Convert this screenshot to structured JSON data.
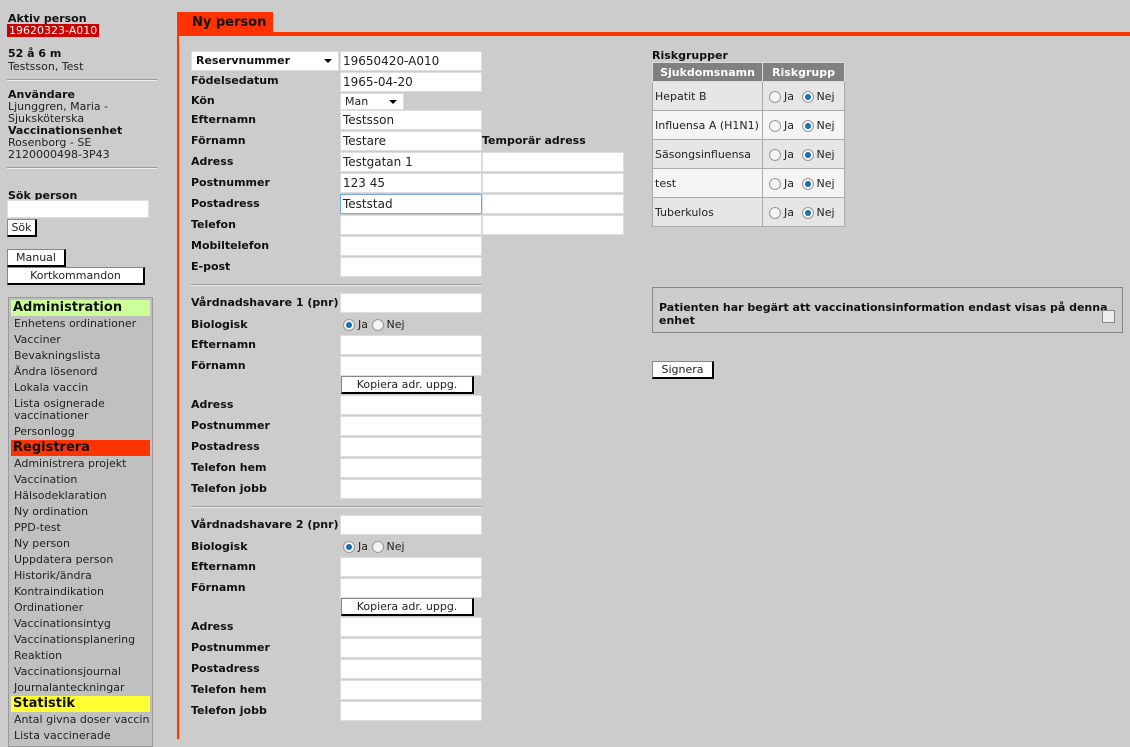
{
  "sidebar": {
    "active_person_label": "Aktiv person",
    "active_person_id": "19620323-A010",
    "age": "52 å 6 m",
    "name": "Testsson, Test",
    "user_label": "Användare",
    "user_name": "Ljunggren, Maria -",
    "user_role": "Sjuksköterska",
    "unit_label": "Vaccinationsenhet",
    "unit_name": "Rosenborg - SE",
    "unit_id": "2120000498-3P43",
    "search_label": "Sök person",
    "search_value": "",
    "search_button": "Sök",
    "manual_button": "Manual",
    "shortcuts_button": "Kortkommandon",
    "menu": {
      "admin_header": "Administration",
      "admin_items": [
        "Enhetens ordinationer",
        "Vacciner",
        "Bevakningslista",
        "Ändra lösenord",
        "Lokala vaccin",
        "Lista osignerade vaccinationer",
        "Personlogg"
      ],
      "register_header": "Registrera",
      "register_items": [
        "Administrera projekt",
        "Vaccination",
        "Hälsodeklaration",
        "Ny ordination",
        "PPD-test",
        "Ny person",
        "Uppdatera person",
        "Historik/ändra",
        "Kontraindikation",
        "Ordinationer",
        "Vaccinationsintyg",
        "Vaccinationsplanering",
        "Reaktion",
        "Vaccinationsjournal",
        "Journalanteckningar"
      ],
      "stats_header": "Statistik",
      "stats_items": [
        "Antal givna doser vaccin",
        "Lista vaccinerade"
      ]
    }
  },
  "colors": {
    "accent": "#ff3300",
    "admin": "#ccff99",
    "stats": "#ffff33",
    "active_id_bg": "#cc0000"
  },
  "tab": {
    "title": "Ny person"
  },
  "form": {
    "id_type": "Reservnummer",
    "id_value": "19650420-A010",
    "birthdate_label": "Födelsedatum",
    "birthdate": "1965-04-20",
    "sex_label": "Kön",
    "sex": "Man",
    "lastname_label": "Efternamn",
    "lastname": "Testsson",
    "firstname_label": "Förnamn",
    "firstname": "Testare",
    "temp_address_label": "Temporär adress",
    "address_label": "Adress",
    "address": "Testgatan 1",
    "zip_label": "Postnummer",
    "zip": "123 45",
    "city_label": "Postadress",
    "city": "Teststad",
    "phone_label": "Telefon",
    "mobile_label": "Mobiltelefon",
    "email_label": "E-post"
  },
  "guardians": [
    {
      "title": "Vårdnadshavare 1 (pnr)",
      "biological_label": "Biologisk",
      "yes": "Ja",
      "no": "Nej",
      "lastname": "Efternamn",
      "firstname": "Förnamn",
      "copy_button": "Kopiera adr. uppg.",
      "address": "Adress",
      "zip": "Postnummer",
      "city": "Postadress",
      "phone_home": "Telefon hem",
      "phone_work": "Telefon jobb"
    },
    {
      "title": "Vårdnadshavare 2 (pnr)",
      "biological_label": "Biologisk",
      "yes": "Ja",
      "no": "Nej",
      "lastname": "Efternamn",
      "firstname": "Förnamn",
      "copy_button": "Kopiera adr. uppg.",
      "address": "Adress",
      "zip": "Postnummer",
      "city": "Postadress",
      "phone_home": "Telefon hem",
      "phone_work": "Telefon jobb"
    }
  ],
  "risk": {
    "title": "Riskgrupper",
    "col1": "Sjukdomsnamn",
    "col2": "Riskgrupp",
    "yes": "Ja",
    "no": "Nej",
    "rows": [
      {
        "name": "Hepatit B",
        "value": "Nej"
      },
      {
        "name": "Influensa A (H1N1)",
        "value": "Nej"
      },
      {
        "name": "Säsongsinfluensa",
        "value": "Nej"
      },
      {
        "name": "test",
        "value": "Nej"
      },
      {
        "name": "Tuberkulos",
        "value": "Nej"
      }
    ]
  },
  "consent": {
    "label": "Patienten har begärt att vaccinationsinformation endast visas på denna enhet",
    "checked": false
  },
  "sign_button": "Signera"
}
